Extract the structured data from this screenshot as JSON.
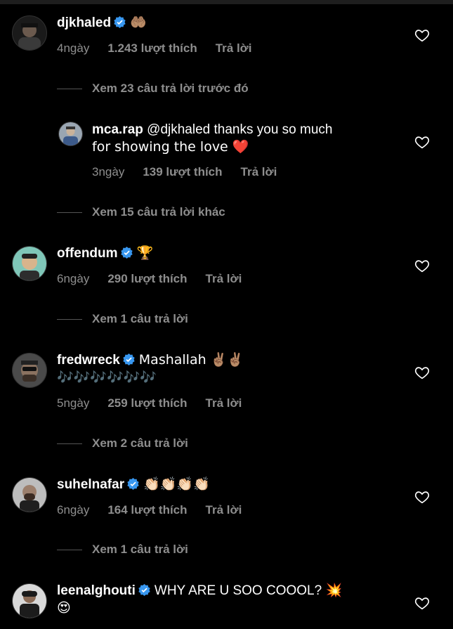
{
  "comments": [
    {
      "username": "djkhaled",
      "text": "🤲🏽",
      "time": "4ngày",
      "likes": "1.243 lượt thích",
      "reply": "Trả lời",
      "view_more": "Xem 23 câu trả lời trước đó"
    },
    {
      "username": "mca.rap",
      "text": "@djkhaled thanks you so much",
      "text2": "for showing the love ❤️",
      "time": "3ngày",
      "likes": "139 lượt thích",
      "reply": "Trả lời",
      "view_more": "Xem 15 câu trả lời khác"
    },
    {
      "username": "offendum",
      "text": "🏆",
      "time": "6ngày",
      "likes": "290 lượt thích",
      "reply": "Trả lời",
      "view_more": "Xem 1 câu trả lời"
    },
    {
      "username": "fredwreck",
      "text": "Mashallah ✌🏽✌🏽",
      "text2": "🎶🎶🎶🎶🎶🎶",
      "time": "5ngày",
      "likes": "259 lượt thích",
      "reply": "Trả lời",
      "view_more": "Xem 2 câu trả lời"
    },
    {
      "username": "suhelnafar",
      "text": "👏🏻👏🏻👏🏻👏🏻",
      "time": "6ngày",
      "likes": "164 lượt thích",
      "reply": "Trả lời",
      "view_more": "Xem 1 câu trả lời"
    },
    {
      "username": "leenalghouti",
      "text": "WHY ARE U SOO COOOL? 💥",
      "text2": "😍"
    }
  ],
  "colors": {
    "background": "#000000",
    "meta": "#8e8e8e",
    "verified": "#3897f0"
  }
}
